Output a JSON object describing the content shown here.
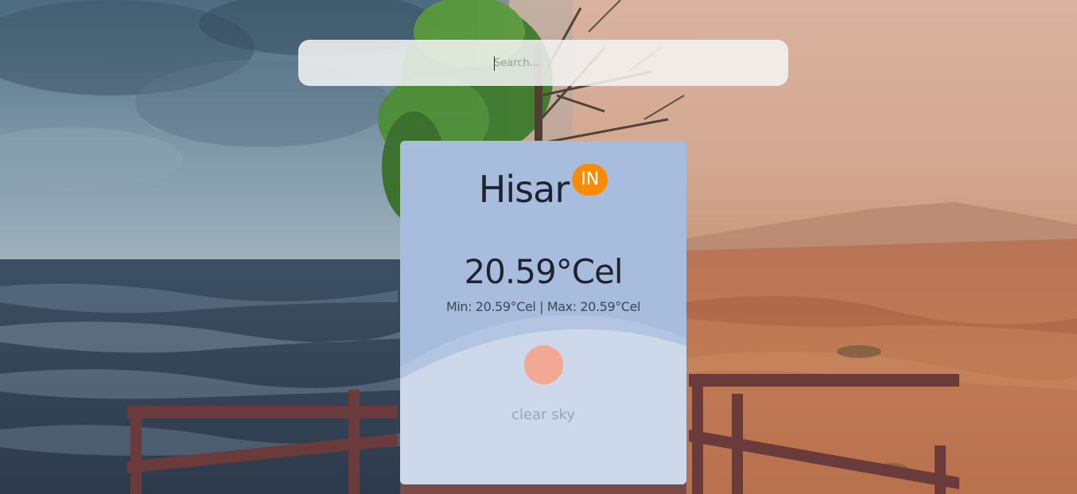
{
  "search": {
    "placeholder": "Search...",
    "value": ""
  },
  "weather": {
    "city": "Hisar",
    "country_code": "IN",
    "temperature": "20.59°Cel",
    "min_max": "Min: 20.59°Cel | Max: 20.59°Cel",
    "description": "clear sky",
    "icon": "sun-icon"
  },
  "colors": {
    "card": "#a8bcdd",
    "badge": "#ff8a00",
    "sun": "#f2a892",
    "search_bar": "#f4f4f4"
  }
}
